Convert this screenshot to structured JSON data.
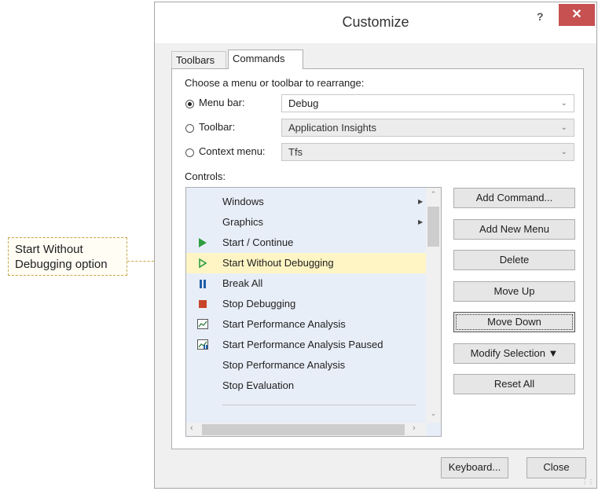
{
  "callout": {
    "text_line1": "Start Without",
    "text_line2": "Debugging option"
  },
  "window": {
    "title": "Customize",
    "help": "?",
    "close": "✕"
  },
  "tabs": [
    {
      "label": "Toolbars"
    },
    {
      "label": "Commands"
    }
  ],
  "rearrange_label": "Choose a menu or toolbar to rearrange:",
  "options": {
    "menu_bar": {
      "label": "Menu bar:",
      "value": "Debug",
      "selected": true
    },
    "toolbar": {
      "label": "Toolbar:",
      "value": "Application Insights",
      "selected": false
    },
    "context_menu": {
      "label": "Context menu:",
      "value": "Tfs",
      "selected": false
    }
  },
  "controls_label": "Controls:",
  "controls": [
    {
      "label": "Windows",
      "icon": "",
      "submenu": "▶"
    },
    {
      "label": "Graphics",
      "icon": "",
      "submenu": "▶"
    },
    {
      "label": "Start / Continue",
      "icon": "play-icon"
    },
    {
      "label": "Start Without Debugging",
      "icon": "play-outline-icon",
      "selected": true
    },
    {
      "label": "Break All",
      "icon": "pause-icon"
    },
    {
      "label": "Stop Debugging",
      "icon": "stop-icon"
    },
    {
      "label": "Start Performance Analysis",
      "icon": "performance-icon"
    },
    {
      "label": "Start Performance Analysis Paused",
      "icon": "performance-paused-icon"
    },
    {
      "label": "Stop Performance Analysis",
      "icon": ""
    },
    {
      "label": "Stop Evaluation",
      "icon": ""
    }
  ],
  "buttons": {
    "add_command": "Add Command...",
    "add_new_menu": "Add New Menu",
    "delete": "Delete",
    "move_up": "Move Up",
    "move_down": "Move Down",
    "modify_selection": "Modify Selection ▼",
    "reset_all": "Reset All",
    "keyboard": "Keyboard...",
    "close": "Close"
  },
  "colors": {
    "selected_row": "#fff5c4",
    "list_bg": "#e8eef8",
    "close_red": "#c75050",
    "play_green": "#2f9e3f",
    "stop_red": "#c8442a",
    "pause_blue": "#1f5fa8"
  }
}
